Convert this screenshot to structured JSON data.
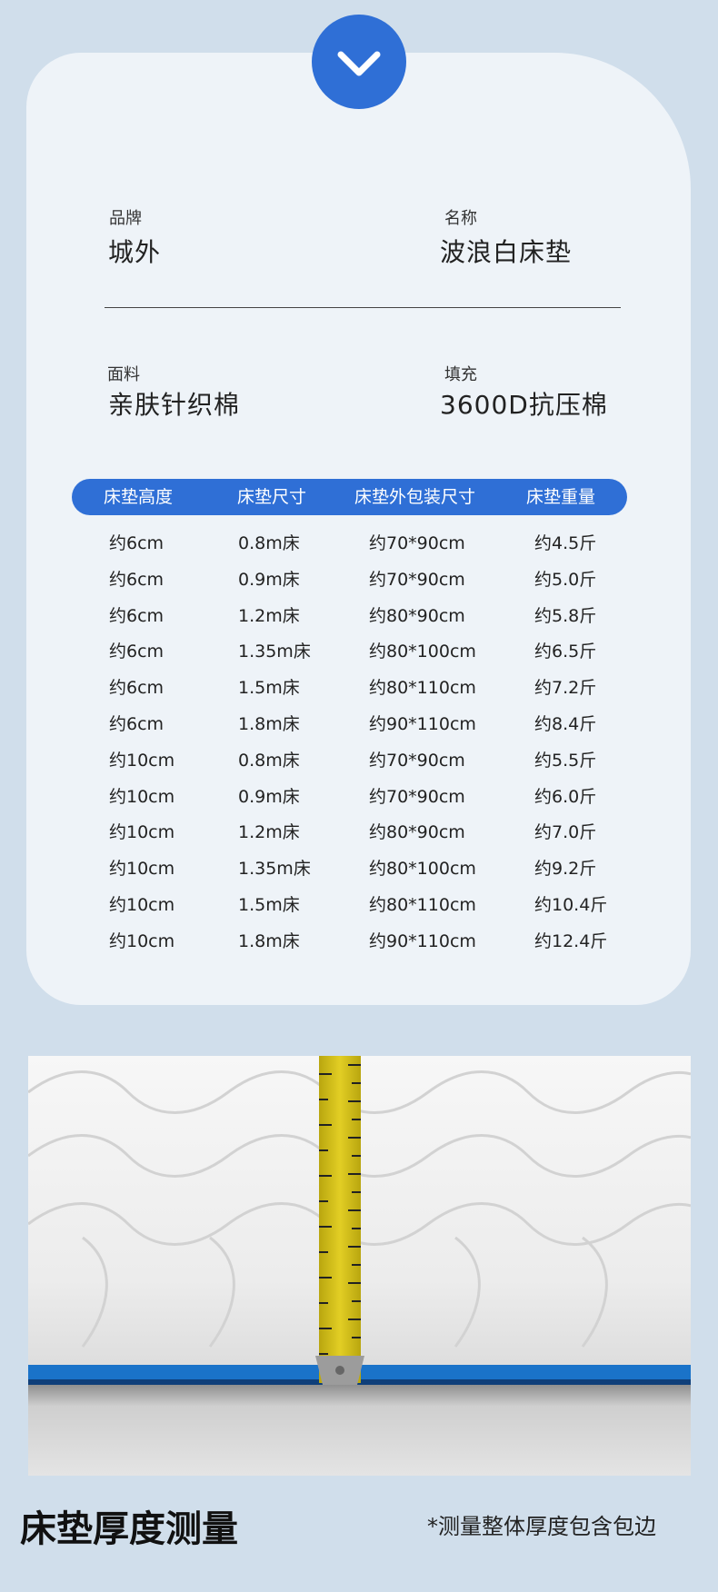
{
  "specs": {
    "brand_label": "品牌",
    "brand_value": "城外",
    "name_label": "名称",
    "name_value": "波浪白床垫",
    "fabric_label": "面料",
    "fabric_value": "亲肤针织棉",
    "filling_label": "填充",
    "filling_value": "3600D抗压棉"
  },
  "table": {
    "headers": [
      "床垫高度",
      "床垫尺寸",
      "床垫外包装尺寸",
      "床垫重量"
    ],
    "rows": [
      [
        "约6cm",
        "0.8m床",
        "约70*90cm",
        "约4.5斤"
      ],
      [
        "约6cm",
        "0.9m床",
        "约70*90cm",
        "约5.0斤"
      ],
      [
        "约6cm",
        "1.2m床",
        "约80*90cm",
        "约5.8斤"
      ],
      [
        "约6cm",
        "1.35m床",
        "约80*100cm",
        "约6.5斤"
      ],
      [
        "约6cm",
        "1.5m床",
        "约80*110cm",
        "约7.2斤"
      ],
      [
        "约6cm",
        "1.8m床",
        "约90*110cm",
        "约8.4斤"
      ],
      [
        "约10cm",
        "0.8m床",
        "约70*90cm",
        "约5.5斤"
      ],
      [
        "约10cm",
        "0.9m床",
        "约70*90cm",
        "约6.0斤"
      ],
      [
        "约10cm",
        "1.2m床",
        "约80*90cm",
        "约7.0斤"
      ],
      [
        "约10cm",
        "1.35m床",
        "约80*100cm",
        "约9.2斤"
      ],
      [
        "约10cm",
        "1.5m床",
        "约80*110cm",
        "约10.4斤"
      ],
      [
        "约10cm",
        "1.8m床",
        "约90*110cm",
        "约12.4斤"
      ]
    ]
  },
  "caption": {
    "title": "床垫厚度测量",
    "note": "*测量整体厚度包含包边"
  },
  "colors": {
    "accent": "#2f6fd6",
    "page_bg": "#d0deeb",
    "card_bg": "#eef3f8",
    "mattress_edge": "#1a73c9",
    "tape_yellow": "#d8c21a"
  },
  "icons": {
    "badge": "chevron-down-icon"
  }
}
